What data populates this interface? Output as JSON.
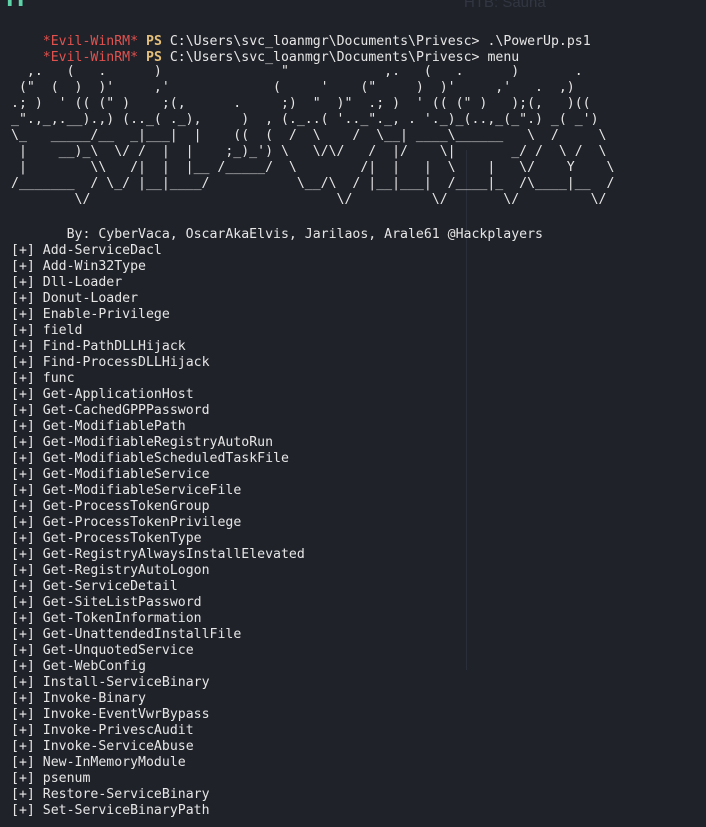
{
  "prompt": {
    "tag": "*Evil-WinRM*",
    "ps": "PS",
    "path": "C:\\Users\\svc_loanmgr\\Documents\\Privesc>"
  },
  "commands": [
    {
      "text": ".\\PowerUp.ps1"
    },
    {
      "text": "menu"
    }
  ],
  "banner": "  ,.   (   .      )               \"            ,.   (   .      )       .\n (\"  (  )  )'     ,'             (     '    (\"     )  )'     ,'   .  ,)\n.; )  ' (( (\" )    ;(,      .     ;)  \"  )\"  .; )  ' (( (\" )   );(,   )((\n_\".,_,.__).,) (.._( ._),     )  , (._..( '.._\"._, . '._)_(..,_(_\".) _( _')\n\\_   _____/__  _|___|  |    ((  (  /  \\    /  \\__| ____\\______   \\  /     \\\n |    __)_\\  \\/ /  |  |    ;_)_') \\   \\/\\/   /  |/    \\|       _/ /  \\ /  \\\n |        \\\\   /|  |  |__ /_____/  \\        /|  |   |  \\    |   \\/    Y    \\\n/_______  / \\_/ |__|____/           \\__/\\  / |__|___|  /____|_  /\\____|__  /\n        \\/                               \\/          \\/       \\/         \\/",
  "credits": "       By: CyberVaca, OscarAkaElvis, Jarilaos, Arale61 @Hackplayers",
  "item_prefix": "[+]",
  "menu_items": [
    "Add-ServiceDacl",
    "Add-Win32Type",
    "Dll-Loader",
    "Donut-Loader",
    "Enable-Privilege",
    "field",
    "Find-PathDLLHijack",
    "Find-ProcessDLLHijack",
    "func",
    "Get-ApplicationHost",
    "Get-CachedGPPPassword",
    "Get-ModifiablePath",
    "Get-ModifiableRegistryAutoRun",
    "Get-ModifiableScheduledTaskFile",
    "Get-ModifiableService",
    "Get-ModifiableServiceFile",
    "Get-ProcessTokenGroup",
    "Get-ProcessTokenPrivilege",
    "Get-ProcessTokenType",
    "Get-RegistryAlwaysInstallElevated",
    "Get-RegistryAutoLogon",
    "Get-ServiceDetail",
    "Get-SiteListPassword",
    "Get-TokenInformation",
    "Get-UnattendedInstallFile",
    "Get-UnquotedService",
    "Get-WebConfig",
    "Install-ServiceBinary",
    "Invoke-Binary",
    "Invoke-EventVwrBypass",
    "Invoke-PrivescAudit",
    "Invoke-ServiceAbuse",
    "New-InMemoryModule",
    "psenum",
    "Restore-ServiceBinary",
    "Set-ServiceBinaryPath"
  ],
  "background_window": {
    "title": "HTB: Sauna"
  },
  "colors": {
    "background": "#1f2229",
    "prompt_tag": "#e0524f",
    "ps_tag": "#e5c07b",
    "text": "#e6e6e6"
  }
}
